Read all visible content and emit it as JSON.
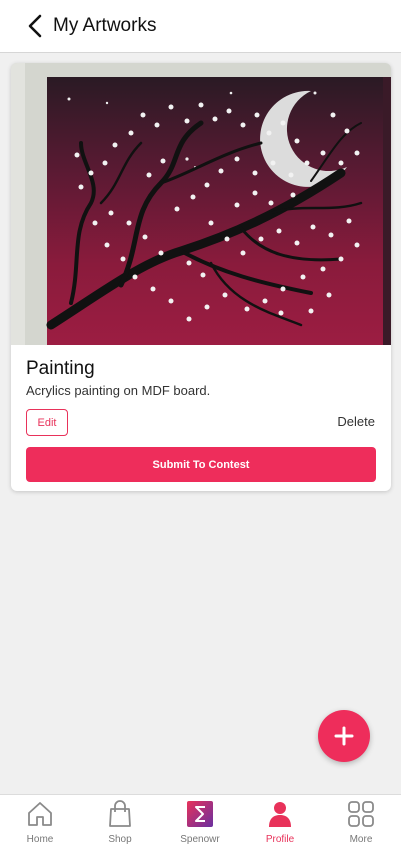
{
  "header": {
    "title": "My Artworks",
    "back_icon": "chevron-left-icon"
  },
  "artwork": {
    "image_description": "painting",
    "title": "Painting",
    "description": "Acrylics painting on MDF board.",
    "edit_label": "Edit",
    "delete_label": "Delete",
    "submit_label": "Submit To Contest"
  },
  "fab": {
    "icon": "plus-icon"
  },
  "bottom_nav": {
    "items": [
      {
        "label": "Home",
        "icon": "home-icon",
        "active": false
      },
      {
        "label": "Shop",
        "icon": "shopping-bag-icon",
        "active": false
      },
      {
        "label": "Spenowr",
        "icon": "spenowr-logo-icon",
        "active": false
      },
      {
        "label": "Profile",
        "icon": "person-icon",
        "active": true
      },
      {
        "label": "More",
        "icon": "grid-icon",
        "active": false
      }
    ]
  },
  "colors": {
    "accent": "#ee2d5b",
    "active_nav": "#e8325a",
    "text_primary": "#111111",
    "background": "#f0f0f0"
  }
}
